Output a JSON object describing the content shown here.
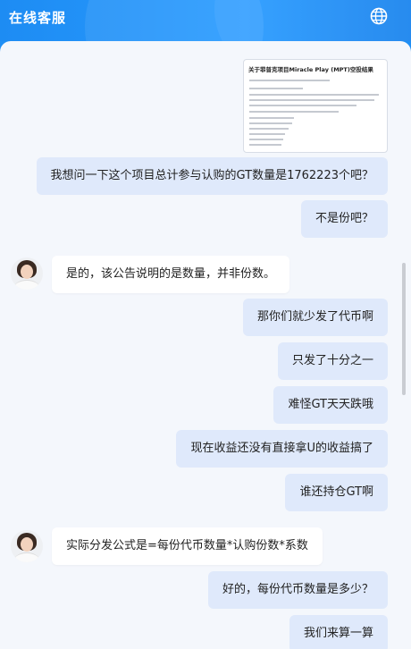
{
  "header": {
    "title": "在线客服",
    "icon": "globe-icon"
  },
  "image_card": {
    "title": "关于菲普克项目Miracle Play (MPT)空投结果"
  },
  "messages": [
    {
      "side": "out",
      "text": "我想问一下这个项目总计参与认购的GT数量是1762223个吧？"
    },
    {
      "side": "out",
      "text": "不是份吧？"
    },
    {
      "side": "in",
      "text": "是的，该公告说明的是数量，并非份数。"
    },
    {
      "side": "out",
      "text": "那你们就少发了代币啊"
    },
    {
      "side": "out",
      "text": "只发了十分之一"
    },
    {
      "side": "out",
      "text": "难怪GT天天跌哦"
    },
    {
      "side": "out",
      "text": "现在收益还没有直接拿U的收益搞了"
    },
    {
      "side": "out",
      "text": "谁还持仓GT啊"
    },
    {
      "side": "in",
      "text": "实际分发公式是=每份代币数量*认购份数*系数"
    },
    {
      "side": "out",
      "text": "好的，每份代币数量是多少？"
    },
    {
      "side": "out",
      "text": "我们来算一算"
    }
  ]
}
